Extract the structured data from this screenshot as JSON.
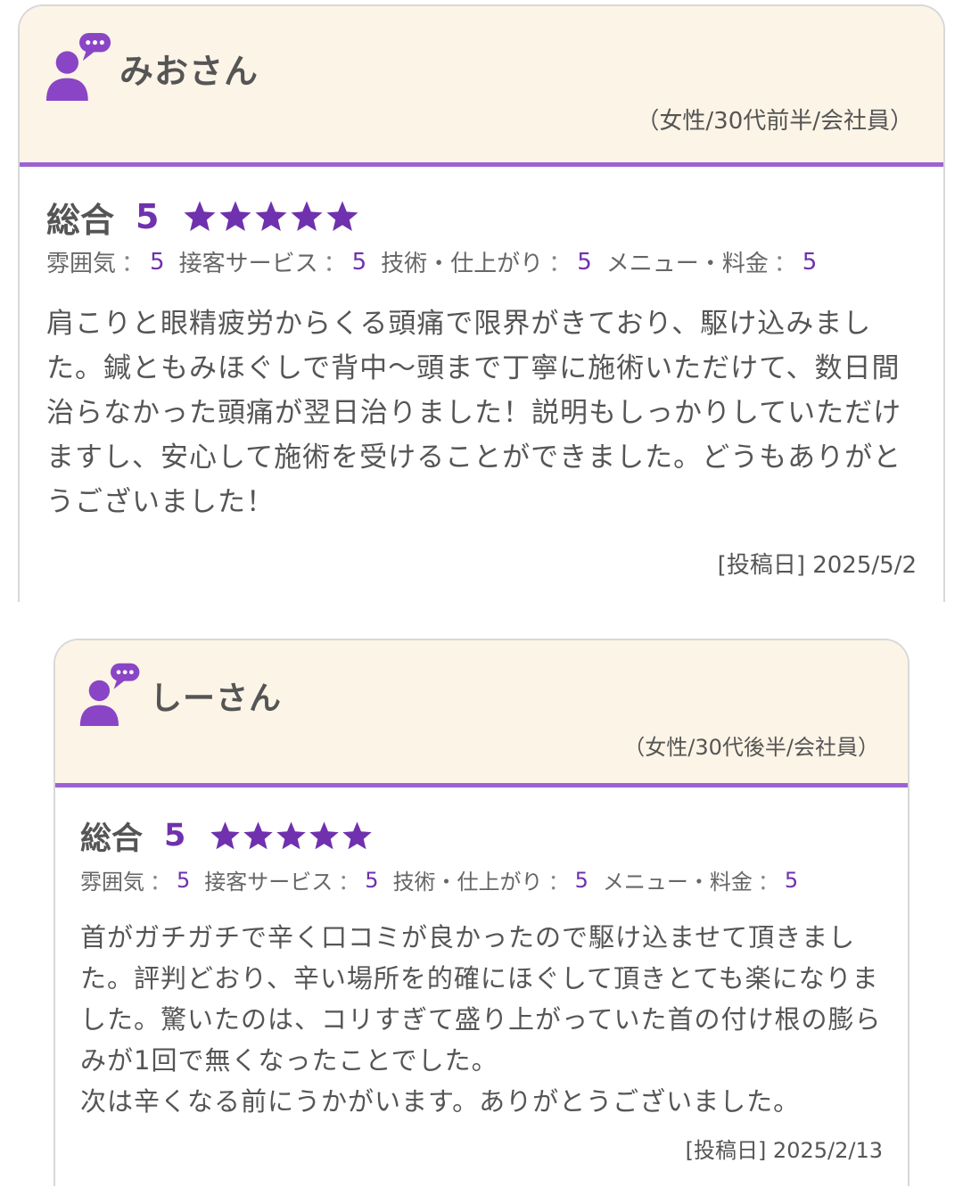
{
  "colors": {
    "header_bg": "#fcf4e6",
    "accent_purple": "#6f31ad",
    "divider_purple": "#9c62d2",
    "text_gray": "#555555"
  },
  "reviews": [
    {
      "name": "みおさん",
      "profile": "（女性/30代前半/会社員）",
      "overall_label": "総合",
      "overall_score": "5",
      "star_rating": 5,
      "sub_ratings": [
        {
          "label": "雰囲気",
          "sep": "：",
          "value": "5"
        },
        {
          "label": "接客サービス",
          "sep": "：",
          "value": "5"
        },
        {
          "label": "技術・仕上がり",
          "sep": "：",
          "value": "5"
        },
        {
          "label": "メニュー・料金",
          "sep": "：",
          "value": "5"
        }
      ],
      "paragraphs": [
        "肩こりと眼精疲労からくる頭痛で限界がきており、駆け込みました。鍼ともみほぐしで背中〜頭まで丁寧に施術いただけて、数日間治らなかった頭痛が翌日治りました！説明もしっかりしていただけますし、安心して施術を受けることができました。どうもありがとうございました！"
      ],
      "post_date": "[投稿日] 2025/5/2"
    },
    {
      "name": "しーさん",
      "profile": "（女性/30代後半/会社員）",
      "overall_label": "総合",
      "overall_score": "5",
      "star_rating": 5,
      "sub_ratings": [
        {
          "label": "雰囲気",
          "sep": "：",
          "value": "5"
        },
        {
          "label": "接客サービス",
          "sep": "：",
          "value": "5"
        },
        {
          "label": "技術・仕上がり",
          "sep": "：",
          "value": "5"
        },
        {
          "label": "メニュー・料金",
          "sep": "：",
          "value": "5"
        }
      ],
      "paragraphs": [
        "首がガチガチで辛く口コミが良かったので駆け込ませて頂きました。評判どおり、辛い場所を的確にほぐして頂きとても楽になりました。驚いたのは、コリすぎて盛り上がっていた首の付け根の膨らみが1回で無くなったことでした。",
        "次は辛くなる前にうかがいます。ありがとうございました。"
      ],
      "post_date": "[投稿日] 2025/2/13"
    }
  ]
}
